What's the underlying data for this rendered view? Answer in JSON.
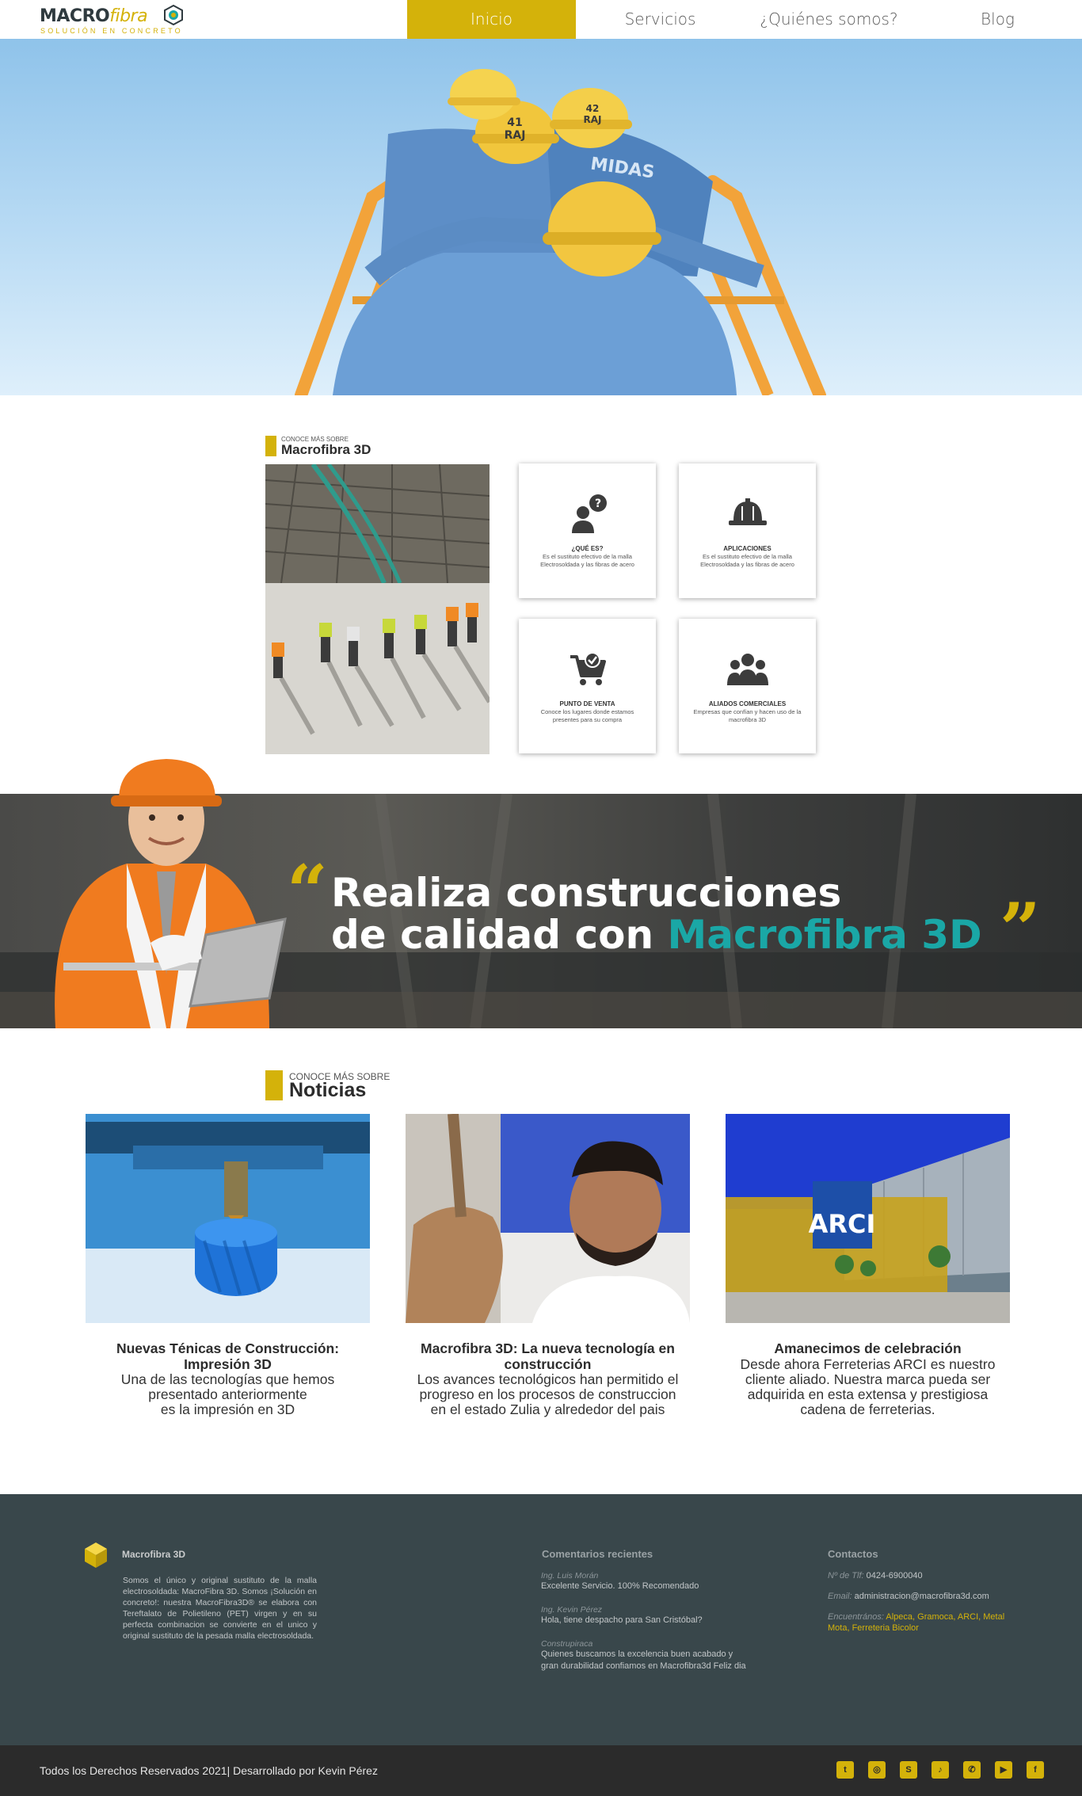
{
  "header": {
    "logo_main": "MACRO",
    "logo_accent": "fibra",
    "logo_sub": "SOLUCIÓN EN CONCRETO",
    "nav": [
      {
        "label": "Inicio",
        "active": true
      },
      {
        "label": "Servicios",
        "active": false
      },
      {
        "label": "¿Quiénes somos?",
        "active": false
      },
      {
        "label": "Blog",
        "active": false
      }
    ]
  },
  "hero": {
    "helmet_1": "41\nRAJ",
    "helmet_2": "42\nRAJ",
    "shirt_text": "MIDAS"
  },
  "about": {
    "label_small": "CONOCE MÁS SOBRE",
    "label_big": "Macrofibra 3D",
    "cards": [
      {
        "title": "¿QUÉ ES?",
        "desc": "Es el sustituto efectivo de la malla Electrosoldada y las fibras de acero",
        "icon": "question-person-icon"
      },
      {
        "title": "APLICACIONES",
        "desc": "Es el sustituto efectivo de la malla Electrosoldada y las fibras de acero",
        "icon": "hard-hat-icon"
      },
      {
        "title": "PUNTO DE VENTA",
        "desc": "Conoce los lugares donde estamos presentes para su compra",
        "icon": "shopping-cart-icon"
      },
      {
        "title": "ALIADOS COMERCIALES",
        "desc": "Empresas que confían y hacen uso de la macrofibra 3D",
        "icon": "group-icon"
      }
    ]
  },
  "banner": {
    "quote_open": "“",
    "quote_close": "”",
    "line1": "Realiza construcciones",
    "line2_plain": "de calidad con ",
    "line2_accent": "Macrofibra 3D"
  },
  "news": {
    "label_small": "CONOCE MÁS SOBRE",
    "label_big": "Noticias",
    "store_sign": "ARCI",
    "items": [
      {
        "title": "Nuevas Ténicas de Construcción: Impresión 3D",
        "desc": "Una de las tecnologías que hemos\npresentado anteriormente\nes la impresión en 3D"
      },
      {
        "title": "Macrofibra 3D: La nueva tecnología en construcción",
        "desc": "Los avances tecnológicos han permitido el\nprogreso en los procesos de construccion\nen el estado Zulia y alrededor del pais"
      },
      {
        "title": "Amanecimos de celebración",
        "desc": "Desde ahora  Ferreterias ARCI es nuestro\ncliente aliado. Nuestra marca pueda ser\nadquirida en esta extensa y prestigiosa\ncadena de ferreterias."
      }
    ]
  },
  "footer": {
    "brand": "Macrofibra 3D",
    "about": "Somos el único y original sustituto de la malla electrosoldada: MacroFibra 3D. Somos ¡Solución en concreto!: nuestra MacroFibra3D® se elabora con Tereftalato de Polietileno (PET) virgen y en su perfecta combinacion se convierte en el unico y original sustituto de la pesada malla electrosoldada.",
    "comments_title": "Comentarios recientes",
    "comments": [
      {
        "name": "Ing. Luis Morán",
        "text": "Excelente Servicio. 100% Recomendado"
      },
      {
        "name": "Ing. Kevin Pérez",
        "text": "Hola, tiene despacho para San Cristóbal?"
      },
      {
        "name": "Construpiraca",
        "text": "Quienes buscamos la excelencia buen acabado y gran durabilidad confiamos en Macrofibra3d Feliz dia"
      }
    ],
    "contact_title": "Contactos",
    "phone_label": "Nº de Tlf:",
    "phone": "0424-6900040",
    "email_label": "Email:",
    "email": "administracion@macrofibra3d.com",
    "find_label": "Encuentrános:",
    "find_places": "Alpeca, Gramoca, ARCI, Metal Mota, Ferreteria Bicolor",
    "copyright": "Todos los Derechos Reservados 2021| Desarrollado por Kevin Pérez",
    "social": [
      {
        "name": "twitter-icon",
        "glyph": "t"
      },
      {
        "name": "instagram-icon",
        "glyph": "◎"
      },
      {
        "name": "skype-icon",
        "glyph": "S"
      },
      {
        "name": "tiktok-icon",
        "glyph": "♪"
      },
      {
        "name": "whatsapp-icon",
        "glyph": "✆"
      },
      {
        "name": "youtube-icon",
        "glyph": "▶"
      },
      {
        "name": "facebook-icon",
        "glyph": "f"
      }
    ],
    "colors": {
      "accent": "#d4b20a",
      "teal": "#1aa7a6",
      "footer_bg": "#39474b",
      "bottom_bg": "#2b2b2b"
    }
  }
}
